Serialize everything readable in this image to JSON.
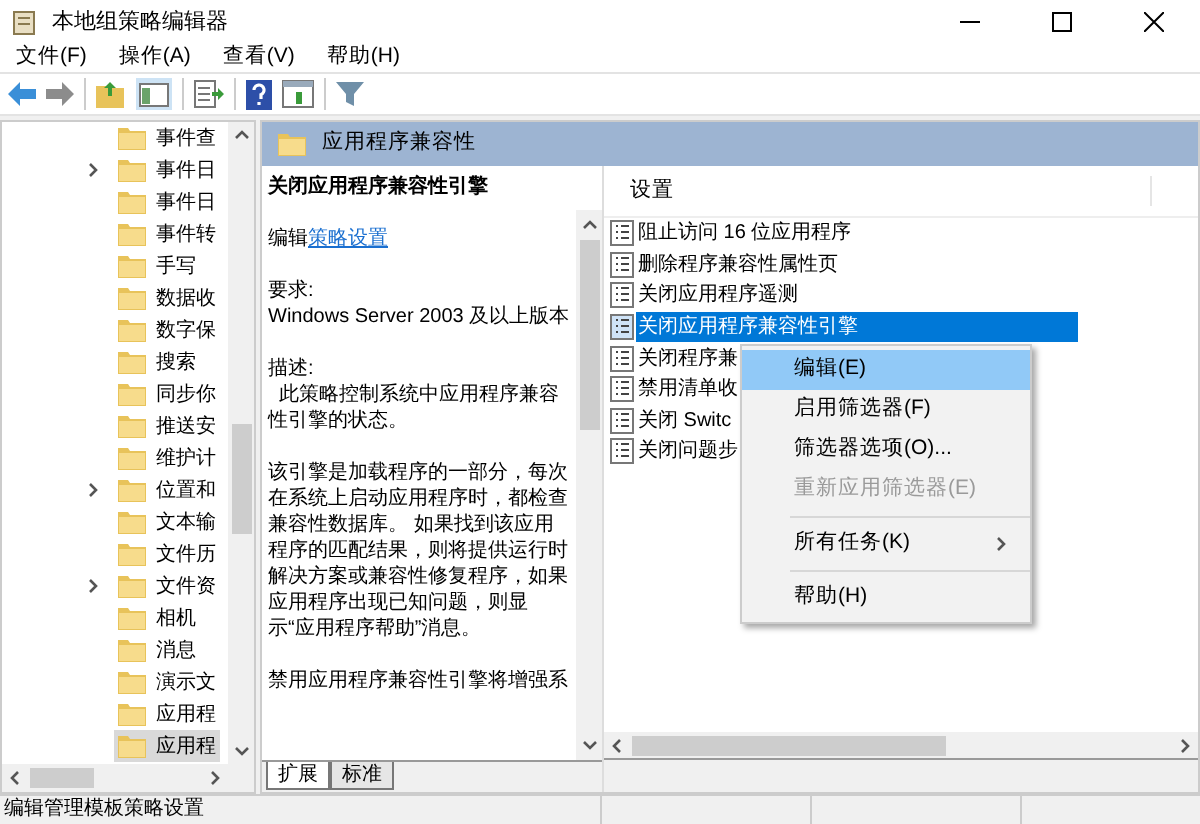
{
  "window": {
    "title": "本地组策略编辑器"
  },
  "menu": [
    "文件(F)",
    "操作(A)",
    "查看(V)",
    "帮助(H)"
  ],
  "tree": {
    "items": [
      {
        "label": "事件查",
        "expandable": false,
        "selected": false
      },
      {
        "label": "事件日",
        "expandable": true,
        "selected": false
      },
      {
        "label": "事件日",
        "expandable": false,
        "selected": false
      },
      {
        "label": "事件转",
        "expandable": false,
        "selected": false
      },
      {
        "label": "手写",
        "expandable": false,
        "selected": false
      },
      {
        "label": "数据收",
        "expandable": false,
        "selected": false
      },
      {
        "label": "数字保",
        "expandable": false,
        "selected": false
      },
      {
        "label": "搜索",
        "expandable": false,
        "selected": false
      },
      {
        "label": "同步你",
        "expandable": false,
        "selected": false
      },
      {
        "label": "推送安",
        "expandable": false,
        "selected": false
      },
      {
        "label": "维护计",
        "expandable": false,
        "selected": false
      },
      {
        "label": "位置和",
        "expandable": true,
        "selected": false
      },
      {
        "label": "文本输",
        "expandable": false,
        "selected": false
      },
      {
        "label": "文件历",
        "expandable": false,
        "selected": false
      },
      {
        "label": "文件资",
        "expandable": true,
        "selected": false
      },
      {
        "label": "相机",
        "expandable": false,
        "selected": false
      },
      {
        "label": "消息",
        "expandable": false,
        "selected": false
      },
      {
        "label": "演示文",
        "expandable": false,
        "selected": false
      },
      {
        "label": "应用程",
        "expandable": false,
        "selected": false
      },
      {
        "label": "应用程",
        "expandable": false,
        "selected": true
      }
    ]
  },
  "header": {
    "title": "应用程序兼容性"
  },
  "description": {
    "title": "关闭应用程序兼容性引擎",
    "edit_prefix": "编辑",
    "edit_link": "策略设置",
    "paragraphs": [
      [
        "要求:",
        "Windows Server 2003 及以上版本"
      ],
      [
        "描述:",
        "  此策略控制系统中应用程序兼容性引擎的状态。"
      ],
      [
        "该引擎是加载程序的一部分，每次在系统上启动应用程序时，都检查兼容性数据库。 如果找到该应用程序的匹配结果，则将提供运行时解决方案或兼容性修复程序，如果应用程序出现已知问题，则显示“应用程序帮助”消息。"
      ],
      [
        "禁用应用程序兼容性引擎将增强系"
      ]
    ],
    "tabs": [
      {
        "label": "扩展",
        "selected": true
      },
      {
        "label": "标准",
        "selected": false
      }
    ]
  },
  "settings": {
    "column": "设置",
    "items": [
      {
        "label": "阻止访问 16 位应用程序",
        "selected": false
      },
      {
        "label": "删除程序兼容性属性页",
        "selected": false
      },
      {
        "label": "关闭应用程序遥测",
        "selected": false
      },
      {
        "label": "关闭应用程序兼容性引擎",
        "selected": true
      },
      {
        "label": "关闭程序兼",
        "selected": false
      },
      {
        "label": "禁用清单收",
        "selected": false
      },
      {
        "label": "关闭 Switc",
        "selected": false
      },
      {
        "label": "关闭问题步",
        "selected": false
      }
    ]
  },
  "context_menu": [
    {
      "label": "编辑(E)",
      "selected": true,
      "disabled": false,
      "submenu": false,
      "separator_before": false
    },
    {
      "label": "启用筛选器(F)",
      "selected": false,
      "disabled": false,
      "submenu": false,
      "separator_before": false
    },
    {
      "label": "筛选器选项(O)...",
      "selected": false,
      "disabled": false,
      "submenu": false,
      "separator_before": false
    },
    {
      "label": "重新应用筛选器(E)",
      "selected": false,
      "disabled": true,
      "submenu": false,
      "separator_before": false
    },
    {
      "label": "所有任务(K)",
      "selected": false,
      "disabled": false,
      "submenu": true,
      "separator_before": true
    },
    {
      "label": "帮助(H)",
      "selected": false,
      "disabled": false,
      "submenu": false,
      "separator_before": true
    }
  ],
  "status_bar": "编辑管理模板策略设置"
}
